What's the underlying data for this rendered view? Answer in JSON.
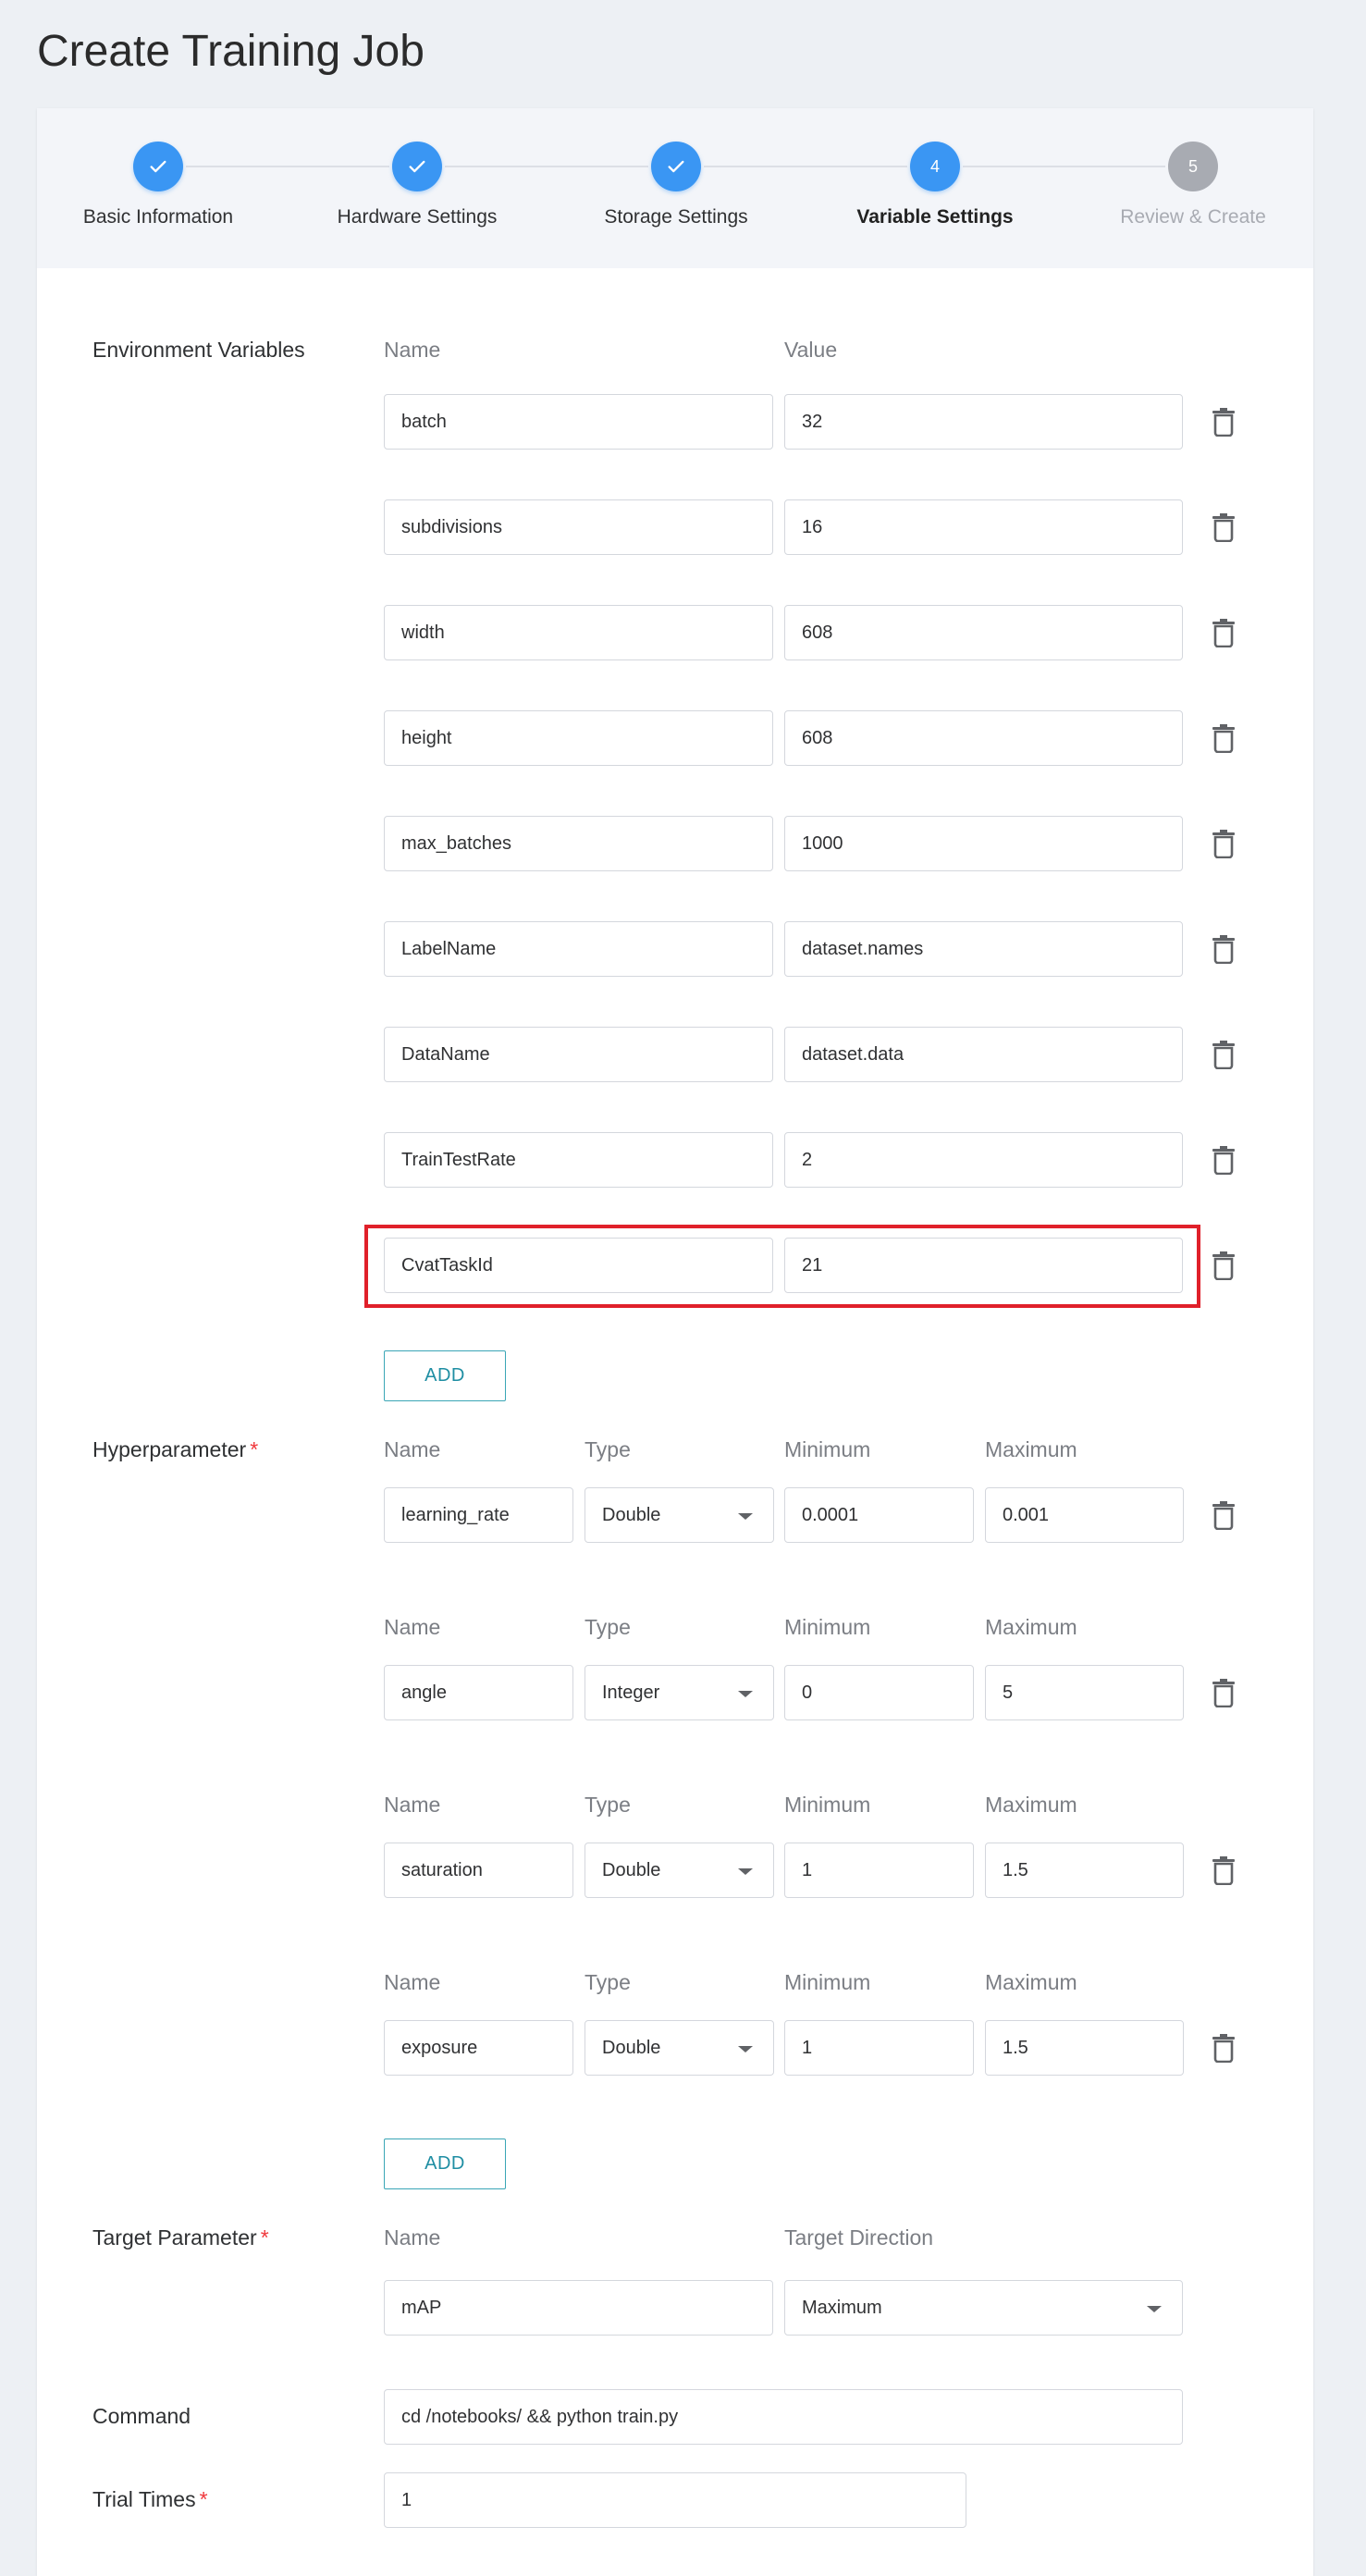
{
  "page_title": "Create Training Job",
  "steps": [
    {
      "label": "Basic Information",
      "state": "done",
      "number": ""
    },
    {
      "label": "Hardware Settings",
      "state": "done",
      "number": ""
    },
    {
      "label": "Storage Settings",
      "state": "done",
      "number": ""
    },
    {
      "label": "Variable Settings",
      "state": "active",
      "number": "4"
    },
    {
      "label": "Review & Create",
      "state": "pending",
      "number": "5"
    }
  ],
  "env": {
    "label": "Environment Variables",
    "name_header": "Name",
    "value_header": "Value",
    "rows": [
      {
        "name": "batch",
        "value": "32"
      },
      {
        "name": "subdivisions",
        "value": "16"
      },
      {
        "name": "width",
        "value": "608"
      },
      {
        "name": "height",
        "value": "608"
      },
      {
        "name": "max_batches",
        "value": "1000"
      },
      {
        "name": "LabelName",
        "value": "dataset.names"
      },
      {
        "name": "DataName",
        "value": "dataset.data"
      },
      {
        "name": "TrainTestRate",
        "value": "2"
      },
      {
        "name": "CvatTaskId",
        "value": "21"
      }
    ],
    "add_label": "ADD"
  },
  "hyper": {
    "label": "Hyperparameter",
    "required_mark": "*",
    "headers": {
      "name": "Name",
      "type": "Type",
      "min": "Minimum",
      "max": "Maximum"
    },
    "rows": [
      {
        "name": "learning_rate",
        "type": "Double",
        "min": "0.0001",
        "max": "0.001"
      },
      {
        "name": "angle",
        "type": "Integer",
        "min": "0",
        "max": "5"
      },
      {
        "name": "saturation",
        "type": "Double",
        "min": "1",
        "max": "1.5"
      },
      {
        "name": "exposure",
        "type": "Double",
        "min": "1",
        "max": "1.5"
      }
    ],
    "add_label": "ADD"
  },
  "target": {
    "label": "Target Parameter",
    "required_mark": "*",
    "name_header": "Name",
    "direction_header": "Target Direction",
    "name_value": "mAP",
    "direction_value": "Maximum"
  },
  "command": {
    "label": "Command",
    "value": "cd /notebooks/ && python train.py"
  },
  "trial": {
    "label": "Trial Times",
    "required_mark": "*",
    "value": "1"
  },
  "colors": {
    "primary": "#3a96f3",
    "pending": "#a8abb2",
    "highlight": "#e0202a",
    "add_border": "#3aa6b6"
  }
}
